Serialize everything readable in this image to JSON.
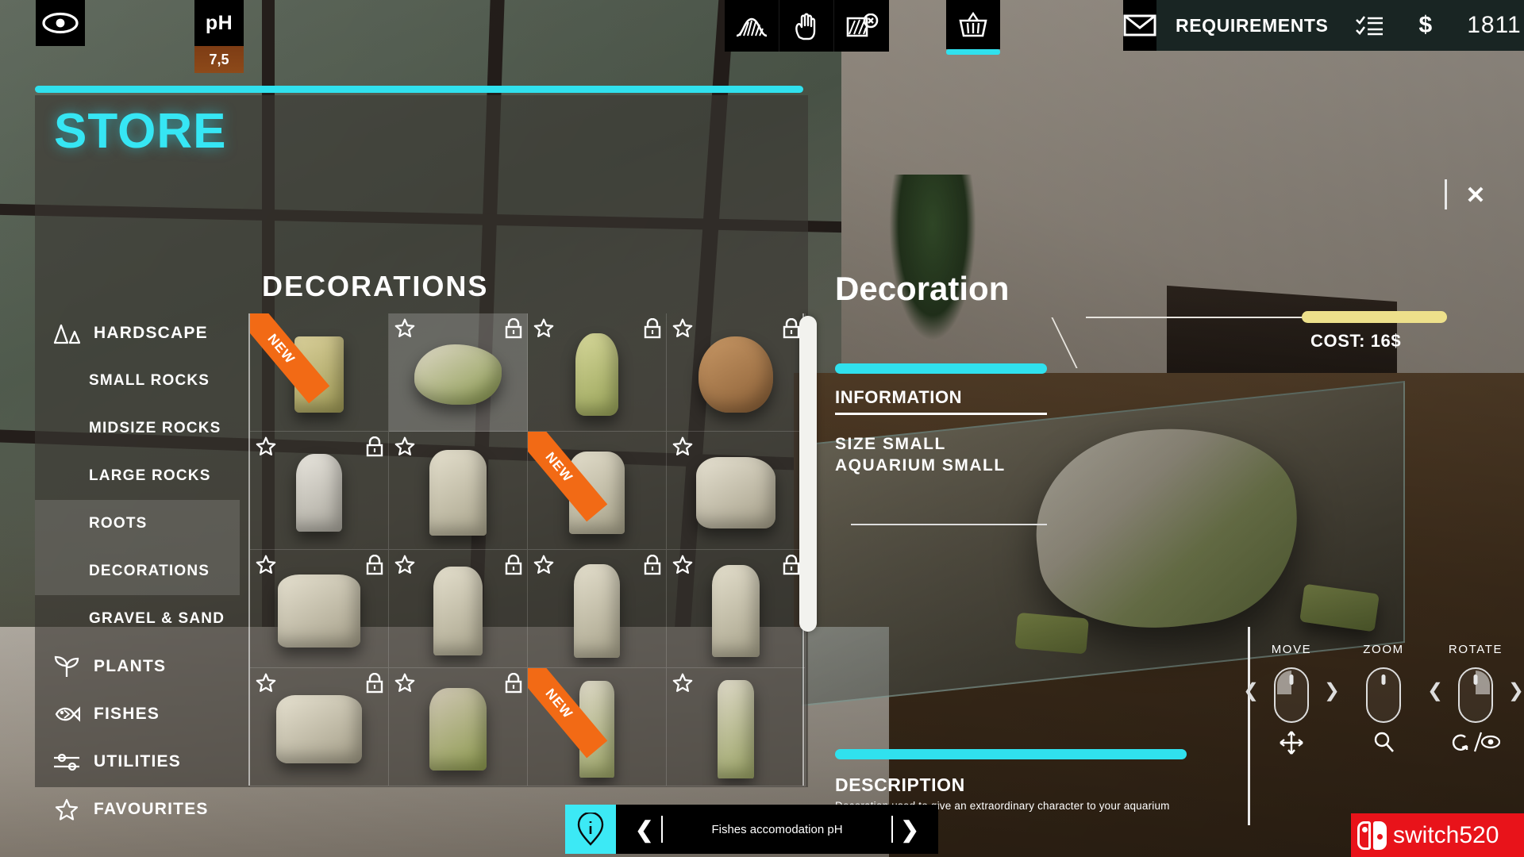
{
  "topbar": {
    "eye_icon": "eye-icon",
    "ph_label": "pH",
    "ph_value": "7,5",
    "tools": [
      {
        "name": "terrain-icon",
        "label": ""
      },
      {
        "name": "hand-icon",
        "label": ""
      },
      {
        "name": "no-terrain-icon",
        "label": ""
      }
    ],
    "basket_icon": "basket-icon",
    "mail_icon": "mail-icon",
    "requirements_label": "REQUIREMENTS",
    "checklist_icon": "checklist-icon",
    "currency_symbol": "$",
    "money": "1811",
    "accent_color": "#30E1EE"
  },
  "store": {
    "title": "STORE",
    "category_title": "DECORATIONS",
    "close_label": "✕",
    "sidebar": [
      {
        "label": "HARDSCAPE",
        "icon": "hardscape-icon",
        "level": "top",
        "active": false
      },
      {
        "label": "SMALL ROCKS",
        "icon": "",
        "level": "sub",
        "active": false
      },
      {
        "label": "MIDSIZE ROCKS",
        "icon": "",
        "level": "sub",
        "active": false
      },
      {
        "label": "LARGE ROCKS",
        "icon": "",
        "level": "sub",
        "active": false
      },
      {
        "label": "ROOTS",
        "icon": "",
        "level": "sub",
        "active": true
      },
      {
        "label": "DECORATIONS",
        "icon": "",
        "level": "sub",
        "active": true
      },
      {
        "label": "GRAVEL & SAND",
        "icon": "",
        "level": "sub",
        "active": false
      },
      {
        "label": "PLANTS",
        "icon": "plant-icon",
        "level": "top",
        "active": false
      },
      {
        "label": "FISHES",
        "icon": "fish-icon",
        "level": "top",
        "active": false
      },
      {
        "label": "UTILITIES",
        "icon": "sliders-icon",
        "level": "top",
        "active": false
      },
      {
        "label": "FAVOURITES",
        "icon": "star-icon",
        "level": "top",
        "active": false
      }
    ],
    "new_badge_label": "NEW",
    "items": [
      {
        "row": 0,
        "col": 0,
        "star": true,
        "locked": false,
        "is_new": true,
        "selected": false,
        "shape": "totem-gold"
      },
      {
        "row": 0,
        "col": 1,
        "star": true,
        "locked": true,
        "is_new": false,
        "selected": true,
        "shape": "shell-mossy"
      },
      {
        "row": 0,
        "col": 2,
        "star": true,
        "locked": true,
        "is_new": false,
        "selected": false,
        "shape": "idol-green"
      },
      {
        "row": 0,
        "col": 3,
        "star": true,
        "locked": true,
        "is_new": false,
        "selected": false,
        "shape": "diver-helmet"
      },
      {
        "row": 1,
        "col": 0,
        "star": true,
        "locked": true,
        "is_new": false,
        "selected": false,
        "shape": "stone-bust"
      },
      {
        "row": 1,
        "col": 1,
        "star": true,
        "locked": false,
        "is_new": false,
        "selected": false,
        "shape": "temple-statue"
      },
      {
        "row": 1,
        "col": 2,
        "star": true,
        "locked": false,
        "is_new": true,
        "selected": false,
        "shape": "temple-statue2"
      },
      {
        "row": 1,
        "col": 3,
        "star": true,
        "locked": false,
        "is_new": false,
        "selected": false,
        "shape": "ruin-wall"
      },
      {
        "row": 2,
        "col": 0,
        "star": true,
        "locked": true,
        "is_new": false,
        "selected": false,
        "shape": "twin-figures"
      },
      {
        "row": 2,
        "col": 1,
        "star": true,
        "locked": true,
        "is_new": false,
        "selected": false,
        "shape": "pillar-idol"
      },
      {
        "row": 2,
        "col": 2,
        "star": true,
        "locked": true,
        "is_new": false,
        "selected": false,
        "shape": "tall-totem"
      },
      {
        "row": 2,
        "col": 3,
        "star": true,
        "locked": true,
        "is_new": false,
        "selected": false,
        "shape": "tall-totem2"
      },
      {
        "row": 3,
        "col": 0,
        "star": true,
        "locked": true,
        "is_new": false,
        "selected": false,
        "shape": "ruins-cluster"
      },
      {
        "row": 3,
        "col": 1,
        "star": true,
        "locked": true,
        "is_new": false,
        "selected": false,
        "shape": "foo-dog"
      },
      {
        "row": 3,
        "col": 2,
        "star": true,
        "locked": false,
        "is_new": true,
        "selected": false,
        "shape": "stone-lantern"
      },
      {
        "row": 3,
        "col": 3,
        "star": true,
        "locked": false,
        "is_new": false,
        "selected": false,
        "shape": "stone-lantern2"
      }
    ]
  },
  "detail": {
    "title": "Decoration",
    "cost_text": "COST: 16$",
    "cost_bar_color": "#EDE08B",
    "information_label": "INFORMATION",
    "info_lines": [
      "SIZE  SMALL",
      "AQUARIUM  SMALL"
    ],
    "description_label": "DESCRIPTION",
    "description_text": "Decoration used to give an extraordinary character to your aquarium"
  },
  "hints": [
    {
      "label": "MOVE",
      "glyph": "move-icon"
    },
    {
      "label": "ZOOM",
      "glyph": "magnifier-icon"
    },
    {
      "label": "ROTATE",
      "glyph": "rotate-eye-icon"
    }
  ],
  "tipbar": {
    "info_icon": "info-icon",
    "prev_label": "❮",
    "text": "Fishes accomodation pH",
    "next_label": "❯"
  },
  "watermark": {
    "text": "switch520",
    "logo": "nintendo-switch-logo",
    "color": "#E8131A"
  }
}
